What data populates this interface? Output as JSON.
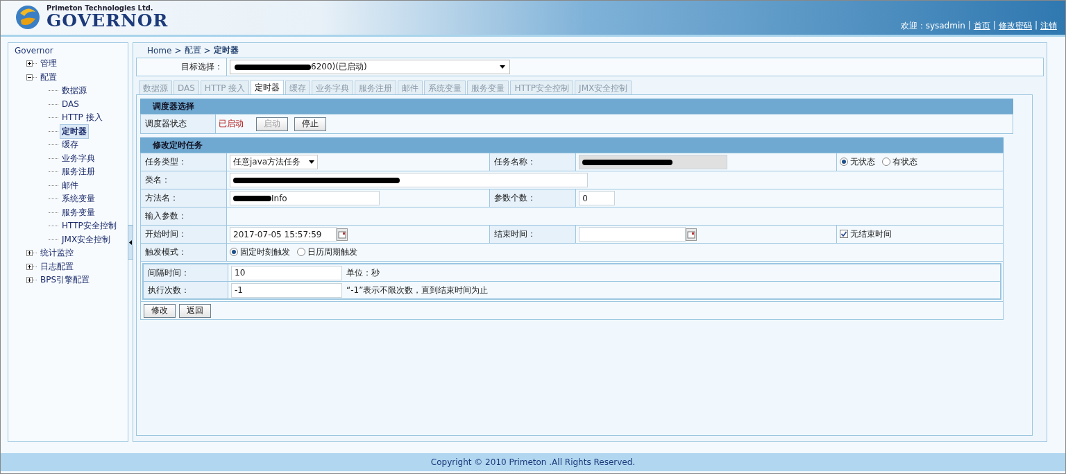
{
  "header": {
    "company": "Primeton Technologies Ltd.",
    "product": "GOVERNOR",
    "welcome": "欢迎：sysadmin",
    "links": [
      "首页",
      "修改密码",
      "注销"
    ],
    "separator": "|"
  },
  "sidebar": {
    "root": "Governor",
    "items": [
      {
        "label": "管理",
        "expanded": false,
        "selected": false
      },
      {
        "label": "配置",
        "expanded": true,
        "selected": false,
        "children": [
          {
            "label": "数据源",
            "selected": false
          },
          {
            "label": "DAS",
            "selected": false
          },
          {
            "label": "HTTP 接入",
            "selected": false
          },
          {
            "label": "定时器",
            "selected": true
          },
          {
            "label": "缓存",
            "selected": false
          },
          {
            "label": "业务字典",
            "selected": false
          },
          {
            "label": "服务注册",
            "selected": false
          },
          {
            "label": "邮件",
            "selected": false
          },
          {
            "label": "系统变量",
            "selected": false
          },
          {
            "label": "服务变量",
            "selected": false
          },
          {
            "label": "HTTP安全控制",
            "selected": false
          },
          {
            "label": "JMX安全控制",
            "selected": false
          }
        ]
      },
      {
        "label": "统计监控",
        "expanded": false,
        "selected": false
      },
      {
        "label": "日志配置",
        "expanded": false,
        "selected": false
      },
      {
        "label": "BPS引擎配置",
        "expanded": false,
        "selected": false
      }
    ]
  },
  "breadcrumb": {
    "items": [
      "Home",
      "配置",
      "定时器"
    ],
    "separator": ">"
  },
  "target": {
    "label": "目标选择：",
    "value": "6200)(已启动)",
    "redacted": true
  },
  "tabs": [
    {
      "label": "数据源",
      "selected": false
    },
    {
      "label": "DAS",
      "selected": false
    },
    {
      "label": "HTTP 接入",
      "selected": false
    },
    {
      "label": "定时器",
      "selected": true
    },
    {
      "label": "缓存",
      "selected": false
    },
    {
      "label": "业务字典",
      "selected": false
    },
    {
      "label": "服务注册",
      "selected": false
    },
    {
      "label": "邮件",
      "selected": false
    },
    {
      "label": "系统变量",
      "selected": false
    },
    {
      "label": "服务变量",
      "selected": false
    },
    {
      "label": "HTTP安全控制",
      "selected": false
    },
    {
      "label": "JMX安全控制",
      "selected": false
    }
  ],
  "scheduler": {
    "title": "调度器选择",
    "label": "调度器状态",
    "status": "已启动",
    "buttons": [
      {
        "label": "启动",
        "disabled": true
      },
      {
        "label": "停止",
        "disabled": false
      }
    ]
  },
  "task": {
    "title": "修改定时任务",
    "task_type": {
      "label": "任务类型：",
      "value": "任意java方法任务"
    },
    "task_name": {
      "label": "任务名称：",
      "redacted": true
    },
    "state": [
      {
        "label": "无状态",
        "selected": true
      },
      {
        "label": "有状态",
        "selected": false
      }
    ],
    "class_name": {
      "label": "类名：",
      "redacted": true
    },
    "method_name": {
      "label": "方法名：",
      "value": "Info",
      "redacted": true
    },
    "param_count": {
      "label": "参数个数：",
      "value": "0"
    },
    "input_params": {
      "label": "输入参数："
    },
    "start_time": {
      "label": "开始时间：",
      "value": "2017-07-05 15:57:59"
    },
    "end_time": {
      "label": "结束时间："
    },
    "no_end": {
      "label": "无结束时间",
      "checked": true
    },
    "trigger": {
      "label": "触发模式：",
      "options": [
        {
          "label": "固定时刻触发",
          "selected": true
        },
        {
          "label": "日历周期触发",
          "selected": false
        }
      ]
    },
    "interval": {
      "label": "间隔时间：",
      "value": "10",
      "note": "单位：秒"
    },
    "count": {
      "label": "执行次数：",
      "value": "-1",
      "note": "“-1”表示不限次数，直到结束时间为止"
    },
    "buttons": [
      "修改",
      "返回"
    ]
  },
  "footer": "Copyright © 2010 Primeton .All Rights Reserved."
}
